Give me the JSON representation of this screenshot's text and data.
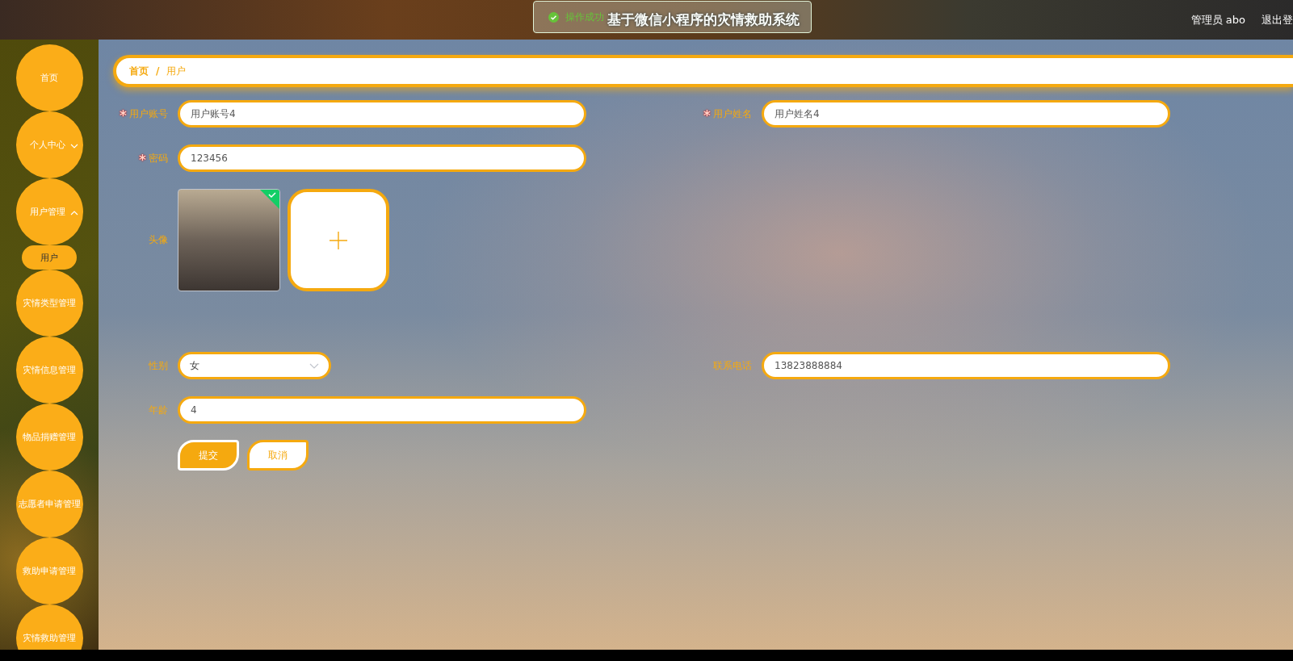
{
  "header": {
    "title": "基于微信小程序的灾情救助系统",
    "user": "管理员 abo",
    "logout": "退出登"
  },
  "toast": {
    "message": "操作成功"
  },
  "sidebar": {
    "items": [
      {
        "label": "首页",
        "expandable": false
      },
      {
        "label": "个人中心",
        "expandable": true,
        "expanded": false
      },
      {
        "label": "用户管理",
        "expandable": true,
        "expanded": true,
        "children": [
          {
            "label": "用户",
            "selected": true
          }
        ]
      },
      {
        "label": "灾情类型管理",
        "expandable": false
      },
      {
        "label": "灾情信息管理",
        "expandable": false
      },
      {
        "label": "物品捐赠管理",
        "expandable": false
      },
      {
        "label": "志愿者申请管理",
        "expandable": false
      },
      {
        "label": "救助申请管理",
        "expandable": false
      },
      {
        "label": "灾情救助管理",
        "expandable": false
      }
    ]
  },
  "breadcrumb": {
    "items": [
      "首页",
      "用户"
    ],
    "separator": "/"
  },
  "form": {
    "rows": [
      [
        {
          "kind": "input",
          "label": "用户账号",
          "required": true,
          "value": "用户账号4"
        },
        {
          "kind": "input",
          "label": "用户姓名",
          "required": true,
          "value": "用户姓名4"
        }
      ],
      [
        {
          "kind": "input",
          "label": "密码",
          "required": true,
          "value": "123456"
        }
      ],
      [
        {
          "kind": "image",
          "label": "头像",
          "required": false,
          "uploaded": true
        }
      ],
      [
        {
          "kind": "select",
          "label": "性别",
          "required": false,
          "value": "女"
        },
        {
          "kind": "input",
          "label": "联系电话",
          "required": false,
          "value": "13823888884"
        }
      ],
      [
        {
          "kind": "input",
          "label": "年龄",
          "required": false,
          "value": "4"
        }
      ]
    ],
    "required_mark": "*",
    "buttons": [
      {
        "label": "提交",
        "primary": true
      },
      {
        "label": "取消",
        "primary": false
      }
    ]
  }
}
